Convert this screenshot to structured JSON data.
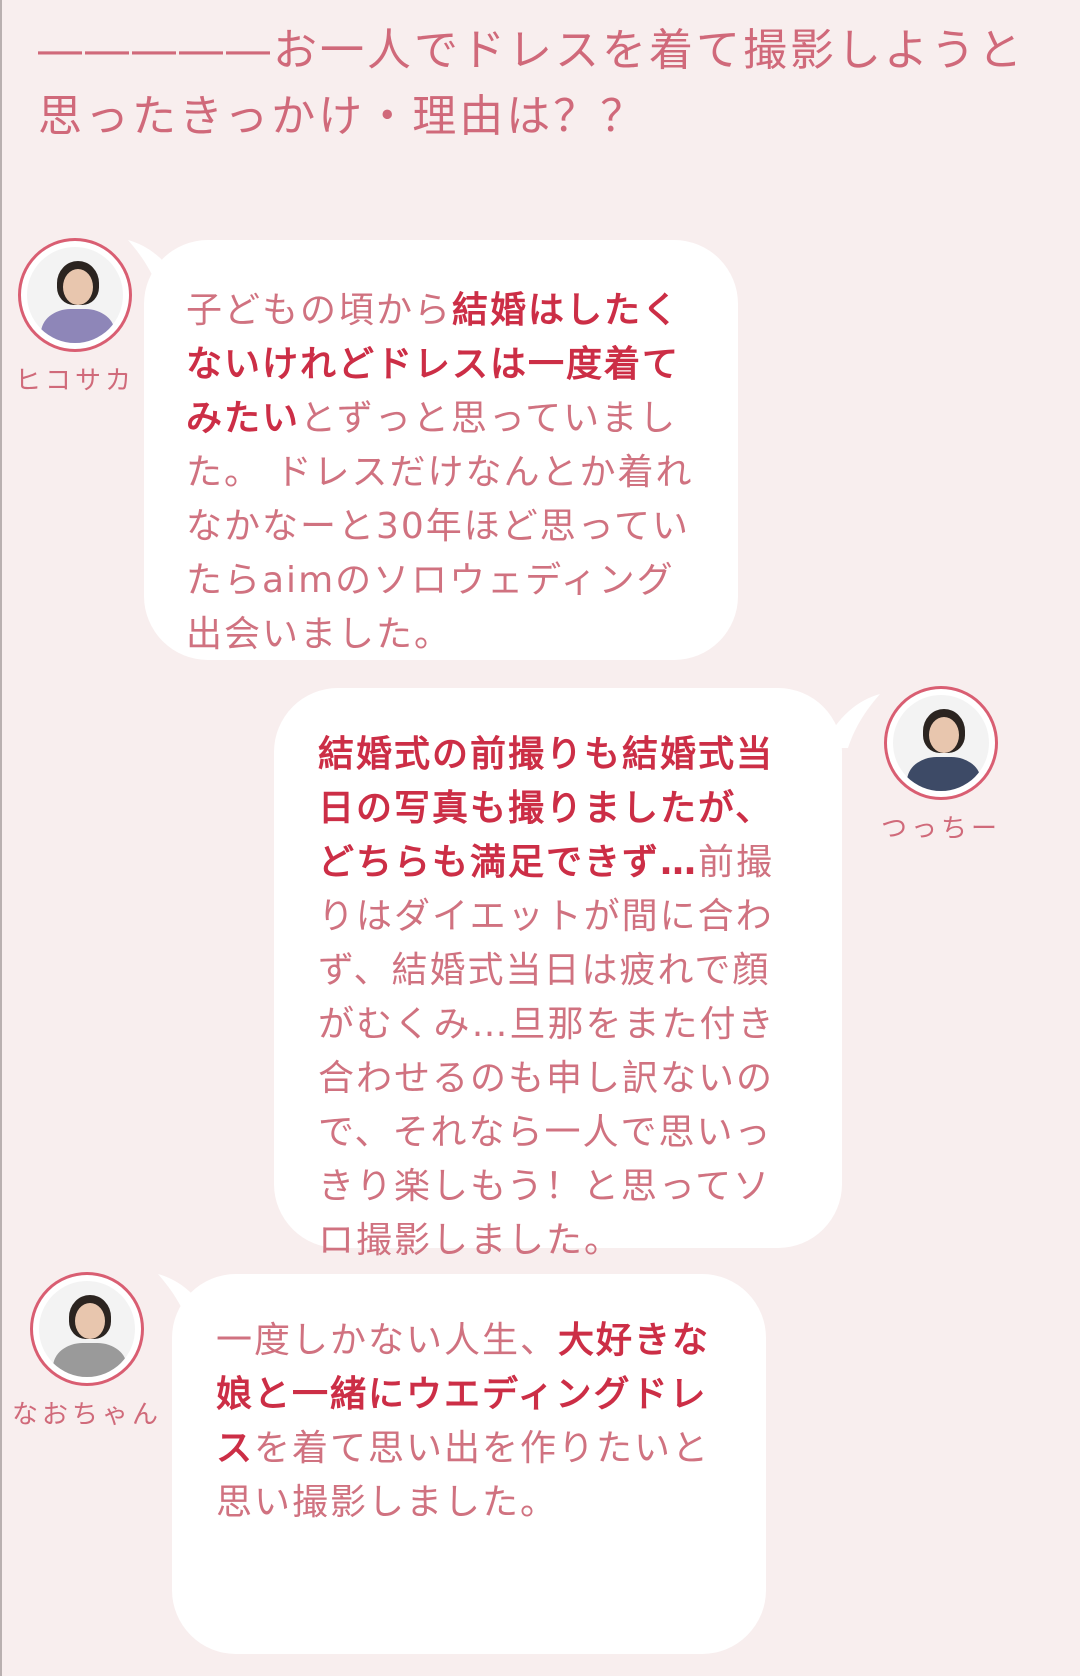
{
  "question": "―――――お一人でドレスを着て撮影しようと思ったきっかけ・理由は？？",
  "colors": {
    "background": "#f8eeee",
    "text": "#d07280",
    "emphasis": "#cc2e46",
    "avatar_ring": "#d95e72"
  },
  "messages": [
    {
      "name": "ヒコサカ",
      "parts": [
        {
          "text": "子どもの頃から",
          "em": false
        },
        {
          "text": "結婚はしたくないけれどドレスは一度着てみたい",
          "em": true
        },
        {
          "text": "とずっと思っていました。 ドレスだけなんとか着れなかなーと30年ほど思っていたらaimのソロウェディング出会いました。",
          "em": false
        }
      ]
    },
    {
      "name": "つっちー",
      "parts": [
        {
          "text": "結婚式の前撮りも結婚式当日の写真も撮りましたが、どちらも満足できず…",
          "em": true
        },
        {
          "text": "前撮りはダイエットが間に合わず、結婚式当日は疲れで顔がむくみ…旦那をまた付き合わせるのも申し訳ないので、それなら一人で思いっきり楽しもう！と思ってソロ撮影しました。",
          "em": false
        }
      ]
    },
    {
      "name": "なおちゃん",
      "parts": [
        {
          "text": "一度しかない人生、",
          "em": false
        },
        {
          "text": "大好きな娘と一緒にウエディングドレス",
          "em": true
        },
        {
          "text": "を着て思い出を作りたいと思い撮影しました。",
          "em": false
        }
      ]
    }
  ]
}
